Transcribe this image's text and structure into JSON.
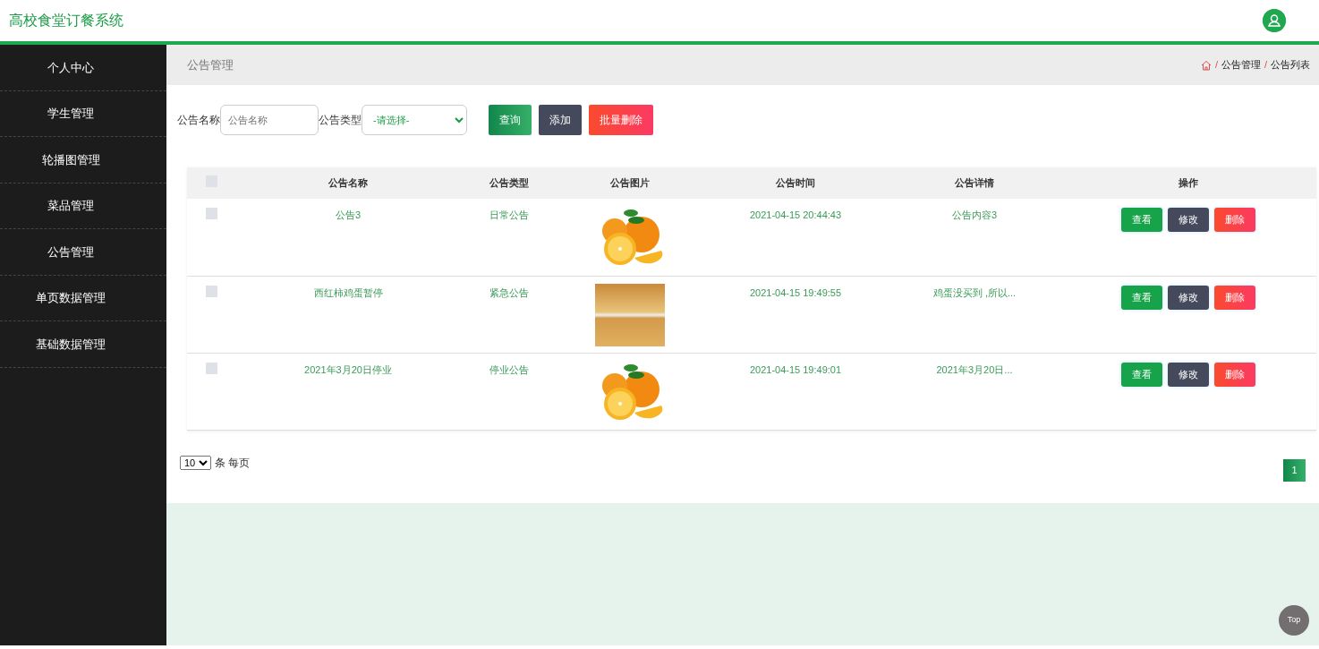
{
  "header": {
    "title": "高校食堂订餐系统"
  },
  "sidebar": {
    "items": [
      {
        "label": "个人中心"
      },
      {
        "label": "学生管理"
      },
      {
        "label": "轮播图管理"
      },
      {
        "label": "菜品管理"
      },
      {
        "label": "公告管理"
      },
      {
        "label": "单页数据管理"
      },
      {
        "label": "基础数据管理"
      }
    ]
  },
  "page_title": "公告管理",
  "breadcrumb": {
    "separator": "/",
    "items": [
      "公告管理",
      "公告列表"
    ]
  },
  "search": {
    "name_label": "公告名称",
    "name_placeholder": "公告名称",
    "type_label": "公告类型",
    "type_value": "-请选择-",
    "buttons": [
      {
        "label": "查询",
        "kind": "query"
      },
      {
        "label": "添加",
        "kind": "add"
      },
      {
        "label": "批量删除",
        "kind": "delete"
      }
    ]
  },
  "table": {
    "columns": [
      "公告名称",
      "公告类型",
      "公告图片",
      "公告时间",
      "公告详情",
      "操作"
    ],
    "header_checked": false,
    "rows": [
      {
        "checked": false,
        "name": "公告3",
        "type": "日常公告",
        "image": {
          "kind": "fruit"
        },
        "time": "2021-04-15 20:44:43",
        "detail": "公告内容3",
        "actions": [
          "查看",
          "修改",
          "删除"
        ]
      },
      {
        "checked": false,
        "name": "西红柿鸡蛋暂停",
        "type": "紧急公告",
        "image": {
          "kind": "photo"
        },
        "time": "2021-04-15 19:49:55",
        "detail": "鸡蛋没买到 ,所以...",
        "actions": [
          "查看",
          "修改",
          "删除"
        ]
      },
      {
        "checked": false,
        "name": "2021年3月20日停业",
        "type": "停业公告",
        "image": {
          "kind": "fruit"
        },
        "time": "2021-04-15 19:49:01",
        "detail": "2021年3月20日...",
        "actions": [
          "查看",
          "修改",
          "删除"
        ]
      }
    ]
  },
  "pagination": {
    "page_size": "10",
    "page_size_label": "条 每页",
    "pages": [
      {
        "label": "1",
        "selected": true
      }
    ]
  },
  "back_to_top": "Top"
}
